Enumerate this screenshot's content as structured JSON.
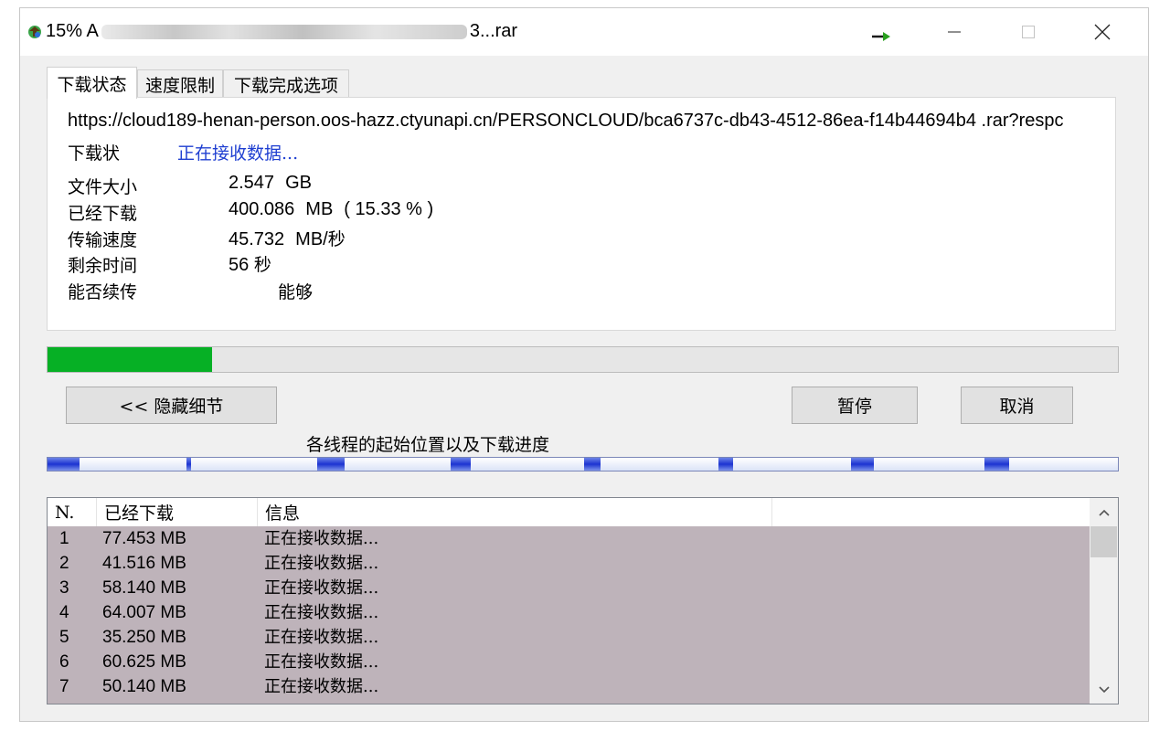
{
  "window": {
    "title_prefix": "15% A",
    "title_suffix": "3...rar",
    "colors": {
      "titlebar": "#ffffff",
      "body": "#f0f0f0",
      "progress_green": "#06b025",
      "status_blue": "#1f3fd1",
      "row_highlight": "#beb3ba"
    }
  },
  "tabs": [
    {
      "label": "下载状态",
      "active": true
    },
    {
      "label": "速度限制",
      "active": false
    },
    {
      "label": "下载完成选项",
      "active": false
    }
  ],
  "details": {
    "url": "https://cloud189-henan-person.oos-hazz.ctyunapi.cn/PERSONCLOUD/bca6737c-db43-4512-86ea-f14b44694b4 .rar?respc",
    "status_label": "下载状",
    "status_value": "正在接收数据...",
    "file_size_label": "文件大小",
    "file_size_value": "2.547",
    "file_size_unit": "GB",
    "downloaded_label": "已经下载",
    "downloaded_value": "400.086",
    "downloaded_unit": "MB",
    "downloaded_percent": "( 15.33 % )",
    "speed_label": "传输速度",
    "speed_value": "45.732",
    "speed_unit": "MB/",
    "speed_unit_cn": "秒",
    "remaining_label": "剩余时间",
    "remaining_value": "56",
    "remaining_unit": "秒",
    "resume_label": "能否续传",
    "resume_value": "能够"
  },
  "progress": {
    "fraction": 0.1533
  },
  "buttons": {
    "hide_details": "<< 隐藏细节",
    "pause": "暂停",
    "cancel": "取消"
  },
  "threads": {
    "caption": "各线程的起始位置以及下载进度"
  },
  "list": {
    "columns": [
      "N.",
      "已经下载",
      "信息",
      ""
    ],
    "rows": [
      {
        "n": "1",
        "downloaded": "77.453  MB",
        "info": "正在接收数据..."
      },
      {
        "n": "2",
        "downloaded": "41.516  MB",
        "info": "正在接收数据..."
      },
      {
        "n": "3",
        "downloaded": "58.140  MB",
        "info": "正在接收数据..."
      },
      {
        "n": "4",
        "downloaded": "64.007  MB",
        "info": "正在接收数据..."
      },
      {
        "n": "5",
        "downloaded": "35.250  MB",
        "info": "正在接收数据..."
      },
      {
        "n": "6",
        "downloaded": "60.625  MB",
        "info": "正在接收数据..."
      },
      {
        "n": "7",
        "downloaded": "50.140  MB",
        "info": "正在接收数据..."
      }
    ]
  },
  "icons": {
    "app": "download-globe-icon",
    "speed_arrow": "green-arrow-icon",
    "minimize": "minimize-icon",
    "maximize": "maximize-icon",
    "close": "close-icon",
    "scroll_up": "chevron-up-icon",
    "scroll_down": "chevron-down-icon"
  }
}
